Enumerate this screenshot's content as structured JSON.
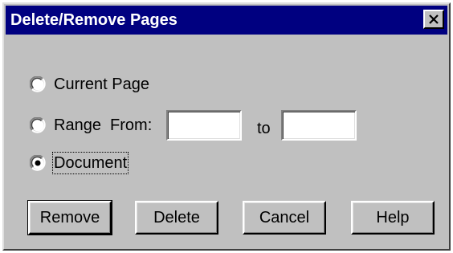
{
  "dialog": {
    "title": "Delete/Remove Pages",
    "close_label": "close"
  },
  "options": {
    "current_page": "Current Page",
    "range_from": "Range  From:",
    "to": "to",
    "document": "Document",
    "selected": "document"
  },
  "fields": {
    "from_value": "",
    "to_value": ""
  },
  "buttons": {
    "remove": "Remove",
    "delete": "Delete",
    "cancel": "Cancel",
    "help": "Help"
  }
}
